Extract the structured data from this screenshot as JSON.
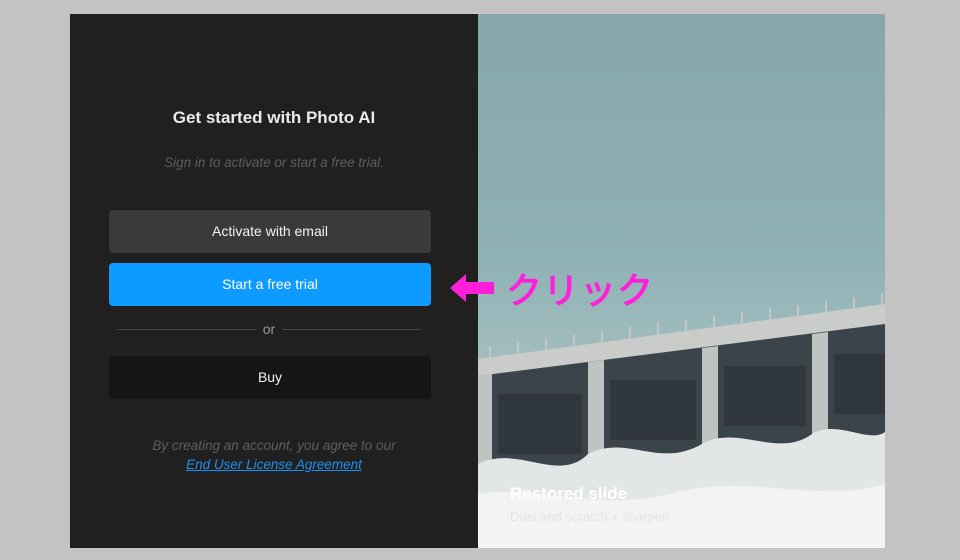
{
  "dialog": {
    "title": "Get started with Photo AI",
    "subtitle": "Sign in to activate or start a free trial.",
    "activate_label": "Activate with email",
    "trial_label": "Start a free trial",
    "divider_label": "or",
    "buy_label": "Buy",
    "legal_text": "By creating an account, you agree to our",
    "legal_link": "End User License Agreement"
  },
  "showcase": {
    "caption_title": "Restored slide",
    "caption_sub": "Dust and scratch + sharpen"
  },
  "annotation": {
    "text": "クリック",
    "color": "#ff1fd8",
    "icon": "left-arrow-icon"
  },
  "colors": {
    "accent": "#0d9bff",
    "panel_bg": "#202020",
    "link": "#1f8ff0"
  }
}
